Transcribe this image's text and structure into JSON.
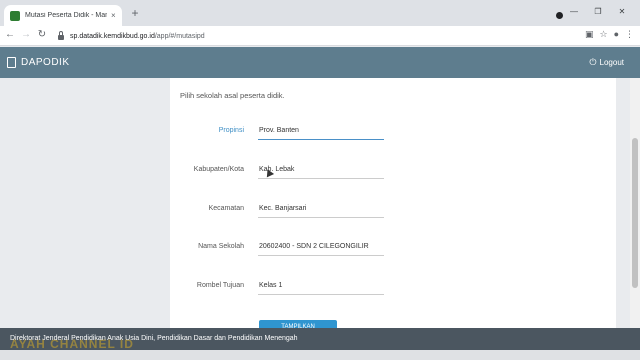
{
  "browser": {
    "tab_title": "Mutasi Peserta Didik - Manajeme",
    "tab_close": "×",
    "new_tab": "+",
    "url_host": "sp.datadik.kemdikbud.go.id",
    "url_path": "/app/#/mutasipd",
    "win_min": "—",
    "win_max": "❐",
    "win_close": "✕"
  },
  "app": {
    "brand": "DAPODIK",
    "logout_label": "Logout"
  },
  "form": {
    "intro": "Pilih sekolah asal peserta didik.",
    "fields": [
      {
        "label": "Propinsi",
        "value": "Prov. Banten"
      },
      {
        "label": "Kabupaten/Kota",
        "value": "Kab. Lebak"
      },
      {
        "label": "Kecamatan",
        "value": "Kec. Banjarsari"
      },
      {
        "label": "Nama Sekolah",
        "value": "20602400 - SDN 2 CILEGONGILIR"
      },
      {
        "label": "Rombel Tujuan",
        "value": "Kelas 1"
      }
    ],
    "submit_label": "TAMPILKAN"
  },
  "footer": {
    "text": "Direktorat Jenderal Pendidikan Anak Usia Dini, Pendidikan Dasar dan Pendidikan Menengah",
    "watermark": "AYAH CHANNEL ID"
  },
  "colors": {
    "appbar": "#5e7d8e",
    "accent": "#3f8fc5",
    "footer": "#4b5660"
  }
}
